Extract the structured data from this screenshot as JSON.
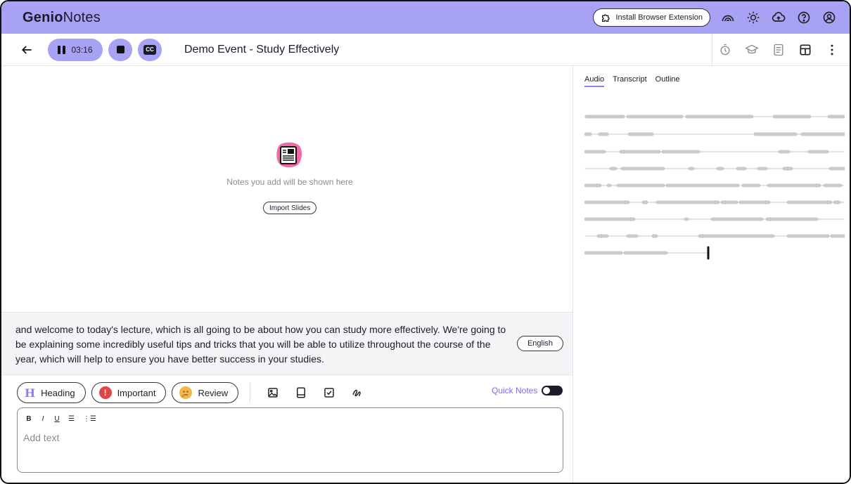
{
  "app": {
    "brand_bold": "Genio",
    "brand_rest": "Notes",
    "install_extension_label": "Install Browser Extension"
  },
  "toolbar": {
    "timer": "03:16",
    "cc_label": "CC",
    "title": "Demo Event - Study Effectively"
  },
  "notes_area": {
    "empty_text": "Notes you add will be shown here",
    "import_label": "Import Slides"
  },
  "transcript": {
    "text": "and welcome to today's lecture, which is all going to be about how you can study more effectively. We're going to be explaining some incredibly useful tips and tricks that you will be able to utilize throughout the course of the year, which will help to ensure you have better success in your studies.",
    "language": "English"
  },
  "note_types": {
    "heading_icon": "H",
    "heading": "Heading",
    "important_icon": "!",
    "important": "Important",
    "review": "Review"
  },
  "quick_notes": {
    "label": "Quick Notes",
    "enabled": false
  },
  "editor": {
    "format_buttons": [
      "B",
      "I",
      "U",
      "☰",
      "⋮☰"
    ],
    "placeholder": "Add text"
  },
  "right_panel": {
    "tabs": [
      "Audio",
      "Transcript",
      "Outline"
    ],
    "active_tab": "Audio"
  },
  "colors": {
    "accent": "#a8a2f5",
    "accent_text": "#7b6cf0",
    "important": "#e14545",
    "review": "#f2b84b"
  },
  "icons": [
    "puzzle-icon",
    "rainbow-icon",
    "sun-icon",
    "cloud-upload-icon",
    "help-icon",
    "account-icon",
    "back-arrow-icon",
    "pause-icon",
    "stop-icon",
    "cc-icon",
    "timer-icon",
    "graduation-cap-icon",
    "document-icon",
    "layout-icon",
    "more-vertical-icon",
    "image-icon",
    "book-icon",
    "checkbox-icon",
    "draw-icon"
  ]
}
